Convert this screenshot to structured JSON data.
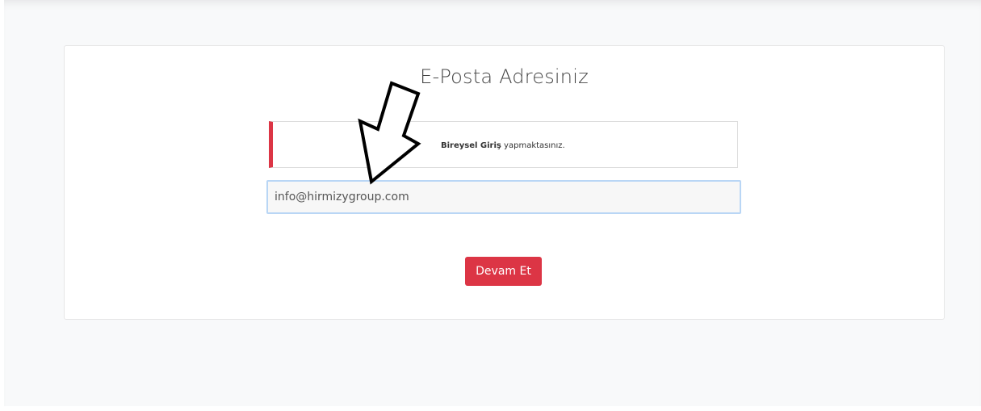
{
  "card": {
    "title": "E-Posta Adresiniz"
  },
  "notice": {
    "bold_text": "Bireysel Giriş",
    "rest_text": " yapmaktasınız."
  },
  "email_field": {
    "value": "info@hirmizygroup.com",
    "placeholder": ""
  },
  "continue_button": {
    "label": "Devam Et"
  },
  "colors": {
    "accent": "#dc3545",
    "input_focus_border": "#b9d6f5",
    "page_background": "#f8f9fa"
  },
  "annotation": {
    "icon": "down-left-arrow-icon"
  }
}
